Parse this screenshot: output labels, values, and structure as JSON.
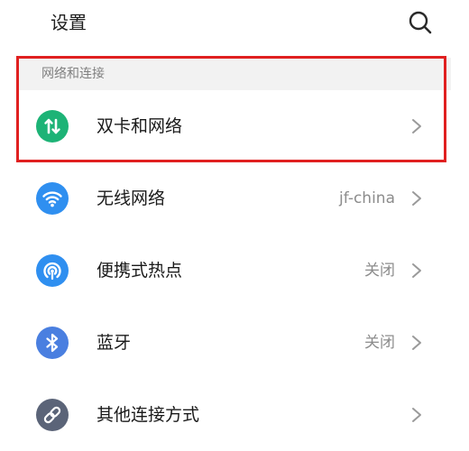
{
  "header": {
    "title": "设置"
  },
  "section": {
    "title": "网络和连接"
  },
  "items": [
    {
      "label": "双卡和网络",
      "value": "",
      "icon": "dual-sim-icon",
      "color": "#1db376"
    },
    {
      "label": "无线网络",
      "value": "jf-china",
      "icon": "wifi-icon",
      "color": "#2f8ff0"
    },
    {
      "label": "便携式热点",
      "value": "关闭",
      "icon": "hotspot-icon",
      "color": "#2f8ff0"
    },
    {
      "label": "蓝牙",
      "value": "关闭",
      "icon": "bluetooth-icon",
      "color": "#4a7fe0"
    },
    {
      "label": "其他连接方式",
      "value": "",
      "icon": "link-icon",
      "color": "#5b6478"
    }
  ],
  "colors": {
    "highlight": "#e02020",
    "section_background": "#f2f2f2"
  }
}
